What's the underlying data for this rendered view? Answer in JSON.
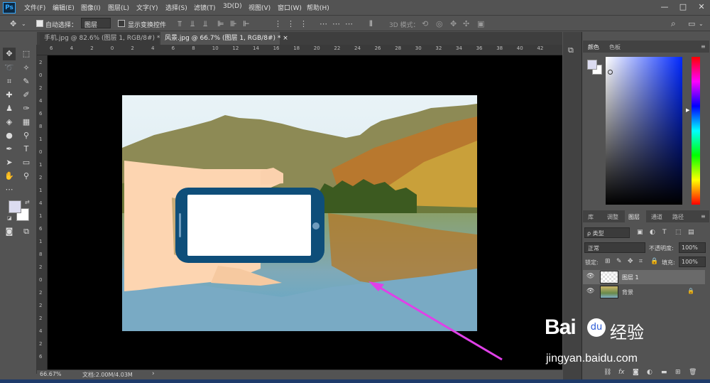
{
  "app": {
    "logo": "Ps"
  },
  "menu": [
    "文件(F)",
    "编辑(E)",
    "图像(I)",
    "图层(L)",
    "文字(Y)",
    "选择(S)",
    "滤镜(T)",
    "3D(D)",
    "视图(V)",
    "窗口(W)",
    "帮助(H)"
  ],
  "window_controls": {
    "minimize": "—",
    "maximize": "□",
    "close": "✕"
  },
  "options_bar": {
    "auto_select_label": "自动选择：",
    "auto_select_value": "图层",
    "show_transform_label": "显示变换控件",
    "mode_3d_label": "3D 模式："
  },
  "tabs": [
    {
      "label": "手机.jpg @ 82.6% (图层 1, RGB/8#) *",
      "close": "×"
    },
    {
      "label": "风景.jpg @ 66.7% (图层 1, RGB/8#) *",
      "close": "×"
    }
  ],
  "ruler_top": [
    "6",
    "4",
    "2",
    "0",
    "2",
    "4",
    "6",
    "8",
    "10",
    "12",
    "14",
    "16",
    "18",
    "20",
    "22",
    "24",
    "26",
    "28",
    "30",
    "32",
    "34",
    "36",
    "38",
    "40",
    "42"
  ],
  "ruler_left": [
    "2",
    "0",
    "2",
    "4",
    "6",
    "8",
    "1",
    "0",
    "1",
    "2",
    "1",
    "4",
    "1",
    "6",
    "1",
    "8",
    "2",
    "0",
    "2",
    "2",
    "2",
    "4",
    "2",
    "6"
  ],
  "status": {
    "zoom": "66.67%",
    "doc": "文档:2.00M/4.03M"
  },
  "color_panel": {
    "tabs": [
      "颜色",
      "色板"
    ]
  },
  "layers_panel": {
    "tabs": [
      "库",
      "调整",
      "图层",
      "通道",
      "路径"
    ],
    "filter_label": "ρ 类型",
    "blend_mode": "正常",
    "opacity_label": "不透明度:",
    "opacity_value": "100%",
    "lock_label": "锁定:",
    "fill_label": "填充:",
    "fill_value": "100%",
    "layers": [
      {
        "name": "图层 1",
        "selected": true
      },
      {
        "name": "背景",
        "locked": true
      }
    ]
  },
  "watermark": {
    "brand": "Bai",
    "brand2": "du",
    "cn": "经验",
    "url": "jingyan.baidu.com"
  },
  "colors": {
    "accent": "#31a8ff",
    "arrow": "#e040e8"
  }
}
